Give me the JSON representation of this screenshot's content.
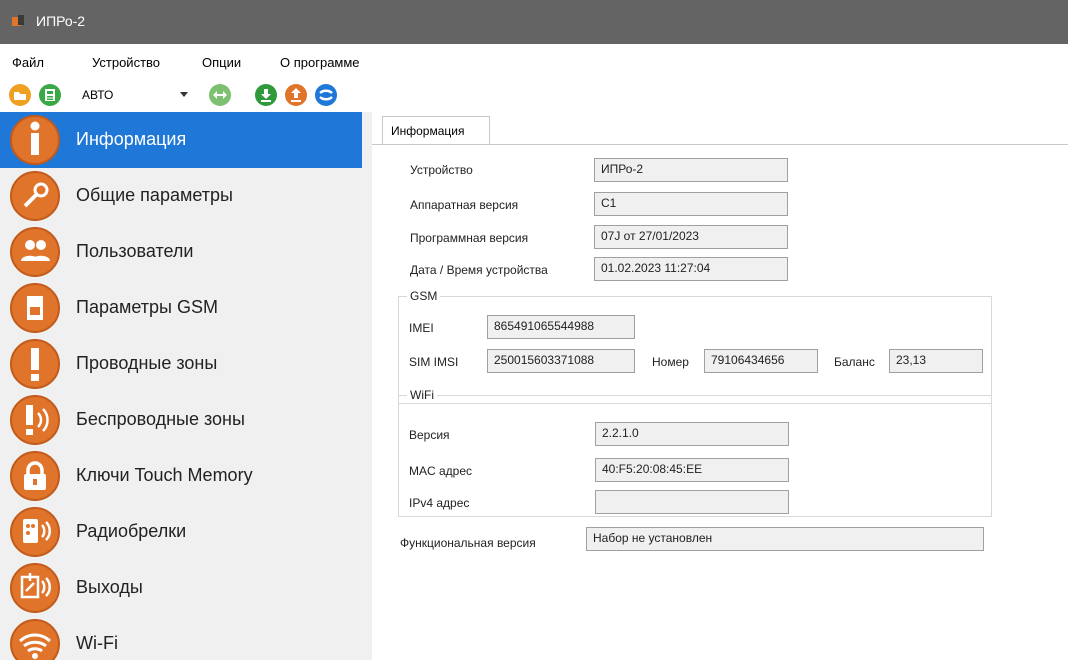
{
  "window": {
    "title": "ИПРо-2"
  },
  "menu": {
    "items": [
      "Файл",
      "Устройство",
      "Опции",
      "О программе"
    ]
  },
  "toolbar": {
    "mode_value": "АВТО"
  },
  "sidebar": {
    "items": [
      {
        "label": "Информация",
        "icon": "info-icon"
      },
      {
        "label": "Общие параметры",
        "icon": "wrench-icon"
      },
      {
        "label": "Пользователи",
        "icon": "users-icon"
      },
      {
        "label": "Параметры GSM",
        "icon": "sim-card-icon"
      },
      {
        "label": "Проводные зоны",
        "icon": "wired-zone-icon"
      },
      {
        "label": "Беспроводные зоны",
        "icon": "wireless-zone-icon"
      },
      {
        "label": "Ключи Touch Memory",
        "icon": "lock-icon"
      },
      {
        "label": "Радиобрелки",
        "icon": "remote-icon"
      },
      {
        "label": "Выходы",
        "icon": "relay-icon"
      },
      {
        "label": "Wi-Fi",
        "icon": "wifi-icon"
      }
    ]
  },
  "tab": {
    "label": "Информация"
  },
  "info": {
    "device_label": "Устройство",
    "device_value": "ИПРо-2",
    "hw_label": "Аппаратная версия",
    "hw_value": "C1",
    "fw_label": "Программная версия",
    "fw_value": "07J от 27/01/2023",
    "dt_label": "Дата / Время устройства",
    "dt_value": "01.02.2023 11:27:04"
  },
  "gsm": {
    "title": "GSM",
    "imei_label": "IMEI",
    "imei_value": "865491065544988",
    "imsi_label": "SIM IMSI",
    "imsi_value": "250015603371088",
    "number_label": "Номер",
    "number_value": "79106434656",
    "balance_label": "Баланс",
    "balance_value": "23,13"
  },
  "wifi": {
    "title": "WiFi",
    "version_label": "Версия",
    "version_value": "2.2.1.0",
    "mac_label": "MAC адрес",
    "mac_value": "40:F5:20:08:45:EE",
    "ipv4_label": "IPv4 адрес",
    "ipv4_value": ""
  },
  "functional": {
    "label": "Функциональная версия",
    "value": "Набор не установлен"
  },
  "colors": {
    "accent": "#1f78d7",
    "icon_orange": "#e0742b",
    "titlebar": "#646464"
  }
}
